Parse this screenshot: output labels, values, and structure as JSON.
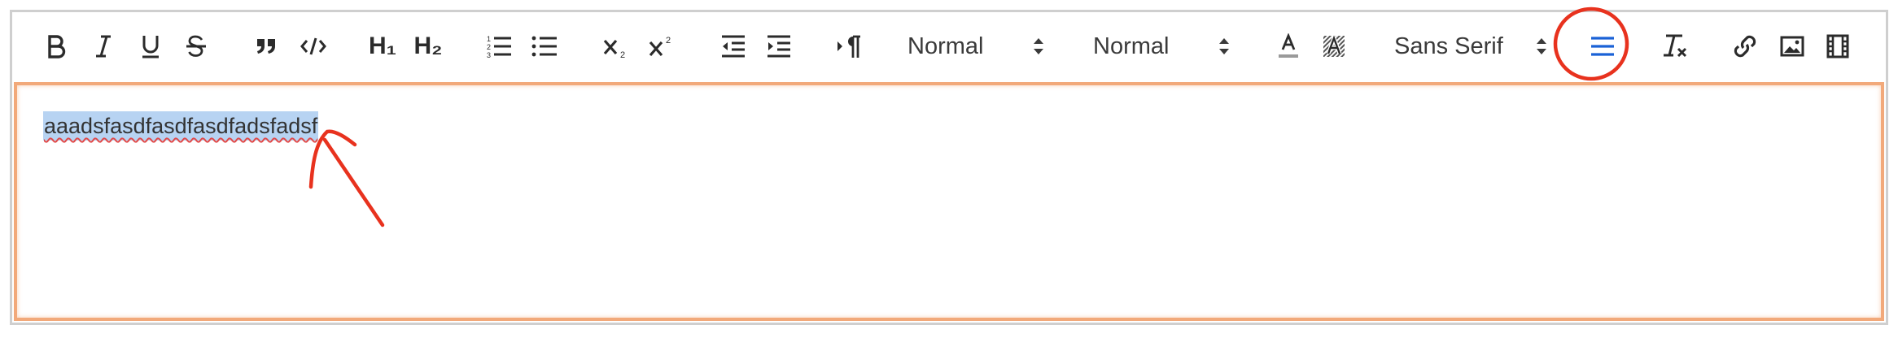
{
  "toolbar": {
    "header1": "H₁",
    "header2": "H₂",
    "size_picker": "Normal",
    "header_picker": "Normal",
    "font_picker": "Sans Serif",
    "icons": [
      "bold-icon",
      "italic-icon",
      "underline-icon",
      "strike-icon",
      "blockquote-icon",
      "code-block-icon",
      "header-1",
      "header-2",
      "ordered-list-icon",
      "bullet-list-icon",
      "subscript-icon",
      "superscript-icon",
      "outdent-icon",
      "indent-icon",
      "rtl-direction-icon",
      "size-picker",
      "header-picker",
      "text-color-icon",
      "background-color-icon",
      "font-picker",
      "align-icon",
      "clean-format-icon",
      "link-icon",
      "image-icon",
      "video-icon"
    ],
    "active_color": "#1a62d6"
  },
  "editor": {
    "content": "aaadsfasdfasdfasdfadsfadsf",
    "focus_border_color": "#f2a97a",
    "selection_color": "#b7d3f2"
  },
  "annotations": {
    "color": "#e8321e"
  }
}
